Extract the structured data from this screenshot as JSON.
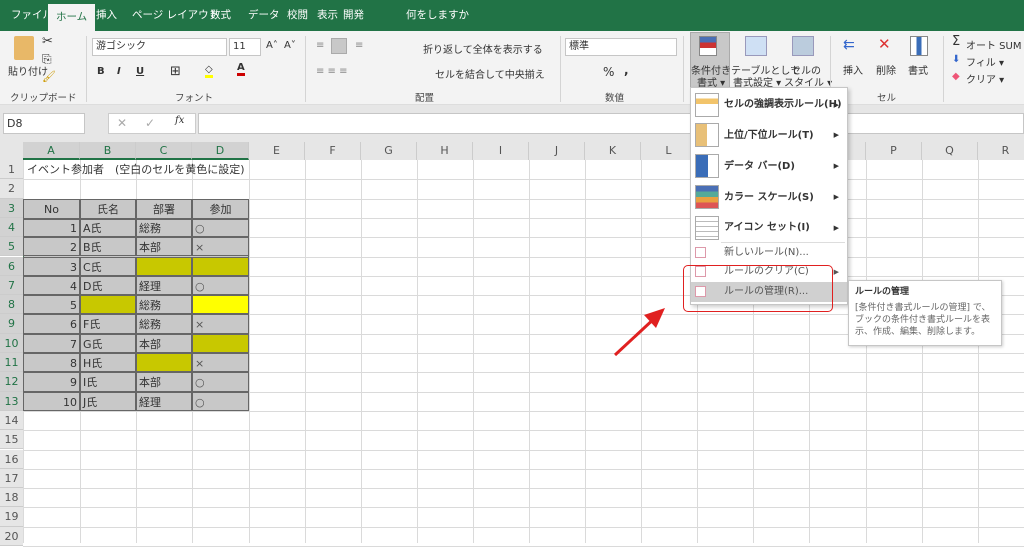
{
  "tabs": [
    "ファイル",
    "ホーム",
    "挿入",
    "ページ レイアウト",
    "数式",
    "データ",
    "校閲",
    "表示",
    "開発",
    "何をしますか"
  ],
  "ribbon": {
    "clipboard": {
      "paste": "貼り付け",
      "group": "クリップボード"
    },
    "font": {
      "name": "游ゴシック",
      "size": "11",
      "bold": "B",
      "italic": "I",
      "underline": "U",
      "group": "フォント"
    },
    "align": {
      "wrap": "折り返して全体を表示する",
      "merge": "セルを結合して中央揃え",
      "group": "配置"
    },
    "number": {
      "format": "標準",
      "percent": "%",
      "comma": ",",
      "group": "数値"
    },
    "styles": {
      "cond1": "条件付き",
      "cond2": "書式 ▾",
      "table1": "テーブルとして",
      "table2": "書式設定 ▾",
      "cell1": "セルの",
      "cell2": "スタイル ▾"
    },
    "cells": {
      "insert": "挿入",
      "delete": "削除",
      "format": "書式",
      "group": "セル"
    },
    "edit": {
      "autosum": "オート SUM",
      "fill": "フィル ▾",
      "clear": "クリア ▾"
    }
  },
  "formula_bar": {
    "name_box": "D8",
    "fx": "fx",
    "value": ""
  },
  "columns": [
    "A",
    "B",
    "C",
    "D",
    "E",
    "F",
    "G",
    "H",
    "I",
    "J",
    "K",
    "L",
    "M",
    "N",
    "O",
    "P",
    "Q",
    "R"
  ],
  "rows": [
    "1",
    "2",
    "3",
    "4",
    "5",
    "6",
    "7",
    "8",
    "9",
    "10",
    "11",
    "12",
    "13",
    "14",
    "15",
    "16",
    "17",
    "18",
    "19",
    "20"
  ],
  "sheet": {
    "title": "イベント参加者　(空白のセルを黄色に設定)",
    "headers": [
      "No",
      "氏名",
      "部署",
      "参加"
    ],
    "data": [
      [
        "1",
        "A氏",
        "総務",
        "○"
      ],
      [
        "2",
        "B氏",
        "本部",
        "×"
      ],
      [
        "3",
        "C氏",
        "",
        ""
      ],
      [
        "4",
        "D氏",
        "経理",
        "○"
      ],
      [
        "5",
        "",
        "総務",
        ""
      ],
      [
        "6",
        "F氏",
        "総務",
        "×"
      ],
      [
        "7",
        "G氏",
        "本部",
        ""
      ],
      [
        "8",
        "H氏",
        "",
        "×"
      ],
      [
        "9",
        "I氏",
        "本部",
        "○"
      ],
      [
        "10",
        "J氏",
        "経理",
        "○"
      ]
    ],
    "colors": {
      "table_fill": "#c8c8c8",
      "blank_fill": "#c8c800",
      "selected_fill": "#ffff00",
      "border": "#4a7a5a"
    }
  },
  "menu": {
    "items": [
      {
        "label": "セルの強調表示ルール(H)",
        "bold": true,
        "sub": true
      },
      {
        "label": "上位/下位ルール(T)",
        "bold": true,
        "sub": true
      },
      {
        "label": "データ バー(D)",
        "bold": true,
        "sub": true
      },
      {
        "label": "カラー スケール(S)",
        "bold": true,
        "sub": true
      },
      {
        "label": "アイコン セット(I)",
        "bold": true,
        "sub": true
      },
      {
        "label": "新しいルール(N)...",
        "bold": false,
        "sub": false
      },
      {
        "label": "ルールのクリア(C)",
        "bold": false,
        "sub": true
      },
      {
        "label": "ルールの管理(R)...",
        "bold": false,
        "sub": false,
        "highlighted": true
      }
    ]
  },
  "tooltip": {
    "title": "ルールの管理",
    "body": "[条件付き書式ルールの管理] で、ブックの条件付き書式ルールを表示、作成、編集、削除します。"
  },
  "annotation_color": "#e02020"
}
